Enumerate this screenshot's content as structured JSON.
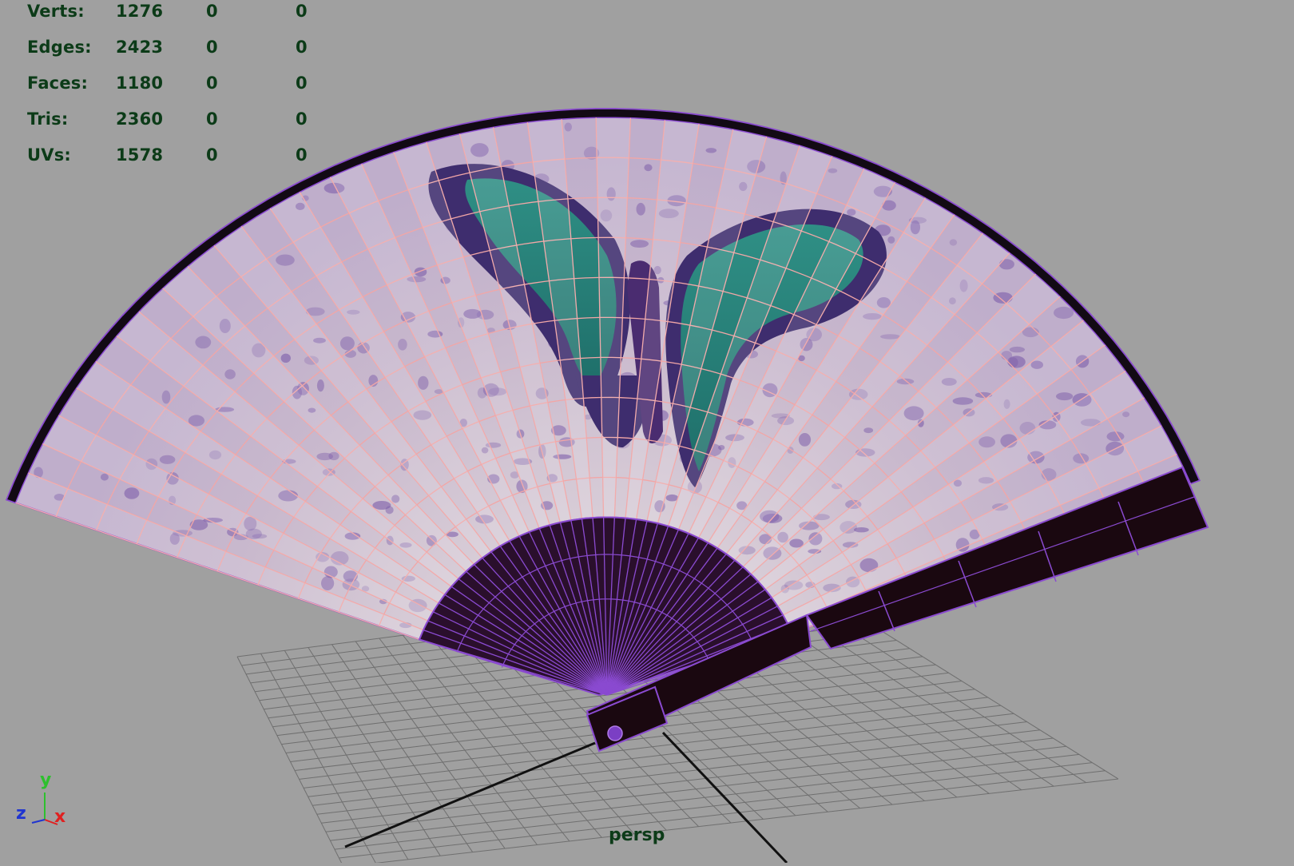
{
  "hud": {
    "rows": [
      {
        "label": "Verts:",
        "total": "1276",
        "selected": "0",
        "extra": "0"
      },
      {
        "label": "Edges:",
        "total": "2423",
        "selected": "0",
        "extra": "0"
      },
      {
        "label": "Faces:",
        "total": "1180",
        "selected": "0",
        "extra": "0"
      },
      {
        "label": "Tris:",
        "total": "2360",
        "selected": "0",
        "extra": "0"
      },
      {
        "label": "UVs:",
        "total": "1578",
        "selected": "0",
        "extra": "0"
      }
    ]
  },
  "viewport": {
    "camera_name": "persp",
    "background_color": "#a0a0a0",
    "hud_text_color": "#0c3b18",
    "wireframe_color": "#f2a6a6",
    "object_highlight_color": "#8a2be2"
  },
  "axis_gizmo": {
    "y_label": "y",
    "z_label": "z",
    "x_label": "x",
    "y_color": "#2ec02e",
    "z_color": "#2035d0",
    "x_color": "#e02020"
  },
  "icons": {
    "fan_model": "folding-fan-mesh",
    "grid": "ground-grid"
  }
}
